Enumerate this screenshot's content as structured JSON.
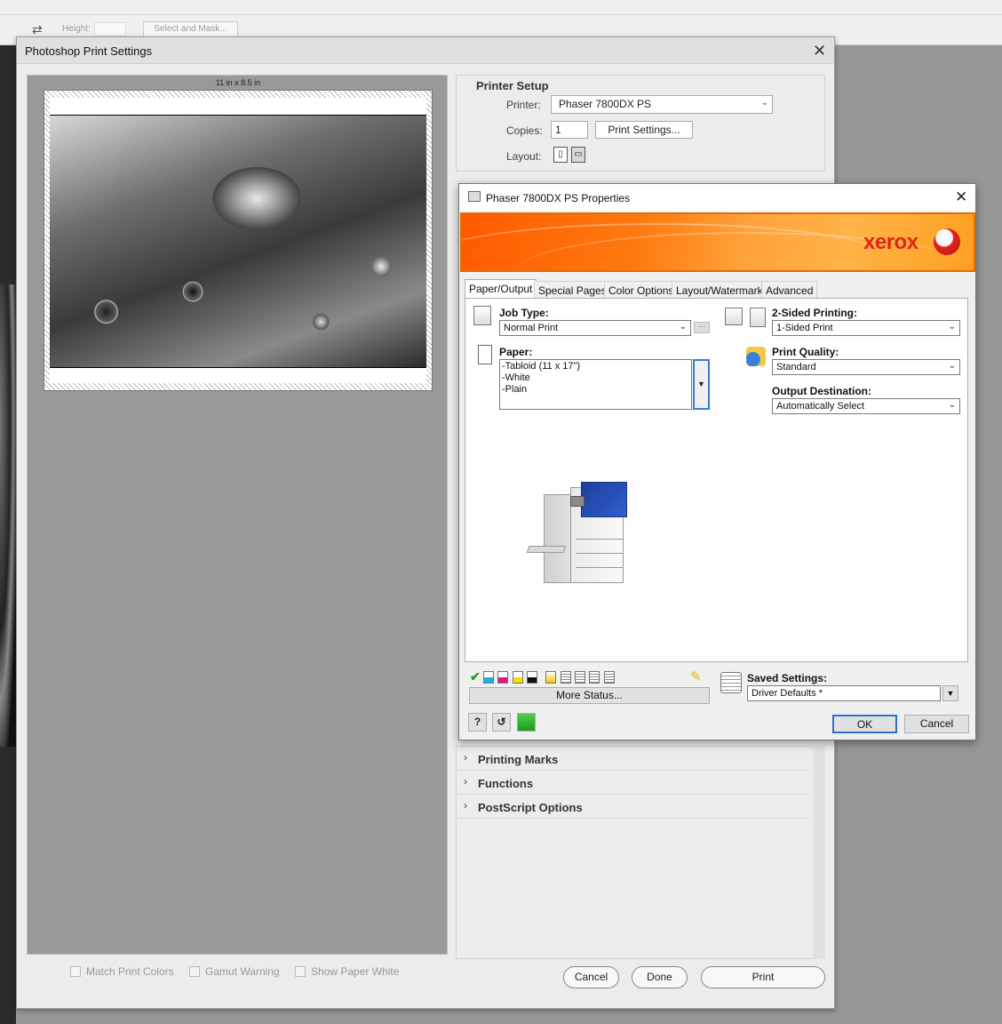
{
  "ps_options": {
    "height_label": "Height:",
    "select_mask_label": "Select and Mask..."
  },
  "ps_dialog": {
    "title": "Photoshop Print Settings",
    "paper_size": "11 in x 8.5 in",
    "printer_setup": {
      "title": "Printer Setup",
      "printer_label": "Printer:",
      "printer_value": "Phaser 7800DX PS",
      "copies_label": "Copies:",
      "copies_value": "1",
      "print_settings_button": "Print Settings...",
      "layout_label": "Layout:"
    },
    "sections": [
      "Printing Marks",
      "Functions",
      "PostScript Options"
    ],
    "checkboxes": [
      "Match Print Colors",
      "Gamut Warning",
      "Show Paper White"
    ],
    "buttons": {
      "cancel": "Cancel",
      "done": "Done",
      "print": "Print"
    }
  },
  "xerox_dialog": {
    "title": "Phaser 7800DX PS Properties",
    "logo": "xerox",
    "tabs": [
      "Paper/Output",
      "Special Pages",
      "Color Options",
      "Layout/Watermark",
      "Advanced"
    ],
    "job_type": {
      "label": "Job Type:",
      "value": "Normal Print"
    },
    "paper": {
      "label": "Paper:",
      "lines": [
        "-Tabloid (11 x 17\")",
        "-White",
        "-Plain"
      ]
    },
    "two_sided": {
      "label": "2-Sided Printing:",
      "value": "1-Sided Print"
    },
    "print_quality": {
      "label": "Print Quality:",
      "value": "Standard"
    },
    "output_destination": {
      "label": "Output Destination:",
      "value": "Automatically Select"
    },
    "more_status": "More Status...",
    "saved_settings": {
      "label": "Saved Settings:",
      "value": "Driver Defaults *"
    },
    "help_glyph": "?",
    "ok": "OK",
    "cancel": "Cancel"
  }
}
